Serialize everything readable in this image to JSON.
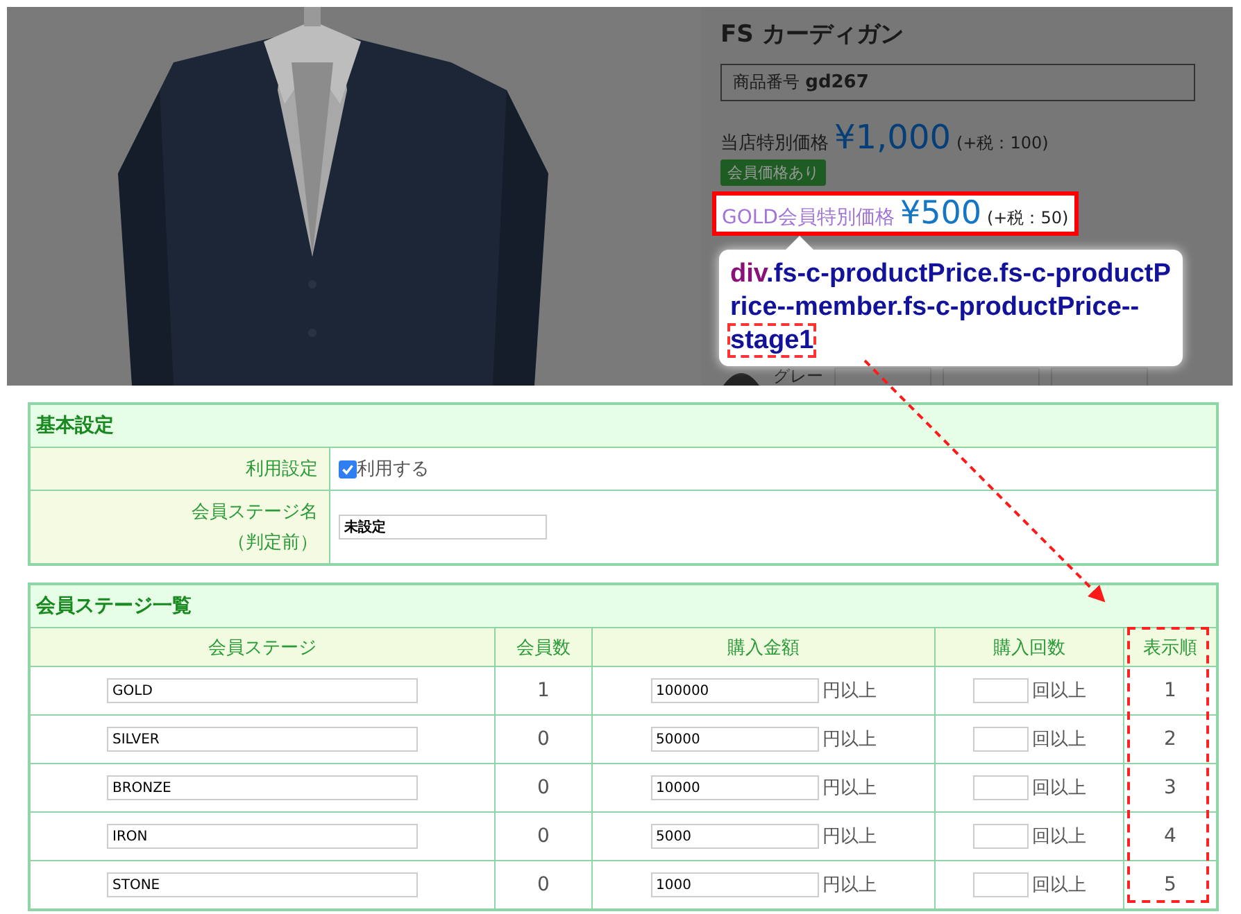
{
  "product": {
    "title": "FS カーディガン",
    "code_label": "商品番号",
    "code": "gd267",
    "price_label": "当店特別価格",
    "price": "¥1,000",
    "tax": "(+税：100)",
    "badge": "会員価格あり",
    "member_price_label": "GOLD会員特別価格",
    "member_price": "¥500",
    "member_tax": "(+税：50)",
    "color_label": "グレー"
  },
  "tooltip": {
    "tag": "div",
    "classes": ".fs-c-productPrice.fs-c-productPrice--member.fs-c-productPrice--",
    "highlight": "stage1"
  },
  "basic": {
    "title": "基本設定",
    "rows": [
      {
        "kind": "checkbox",
        "label": "利用設定",
        "checked": true,
        "text": "利用する"
      },
      {
        "kind": "input",
        "label": "会員ステージ名",
        "sublabel": "（判定前）",
        "value": "未設定"
      }
    ]
  },
  "stages": {
    "title": "会員ステージ一覧",
    "columns": [
      "会員ステージ",
      "会員数",
      "購入金額",
      "購入回数",
      "表示順"
    ],
    "rows": [
      {
        "name": "GOLD",
        "members": "1",
        "amount": "100000",
        "amount_unit": "円以上",
        "count_unit": "回以上",
        "order": "1"
      },
      {
        "name": "SILVER",
        "members": "0",
        "amount": "50000",
        "amount_unit": "円以上",
        "count_unit": "回以上",
        "order": "2"
      },
      {
        "name": "BRONZE",
        "members": "0",
        "amount": "10000",
        "amount_unit": "円以上",
        "count_unit": "回以上",
        "order": "3"
      },
      {
        "name": "IRON",
        "members": "0",
        "amount": "5000",
        "amount_unit": "円以上",
        "count_unit": "回以上",
        "order": "4"
      },
      {
        "name": "STONE",
        "members": "0",
        "amount": "1000",
        "amount_unit": "円以上",
        "count_unit": "回以上",
        "order": "5"
      }
    ]
  }
}
